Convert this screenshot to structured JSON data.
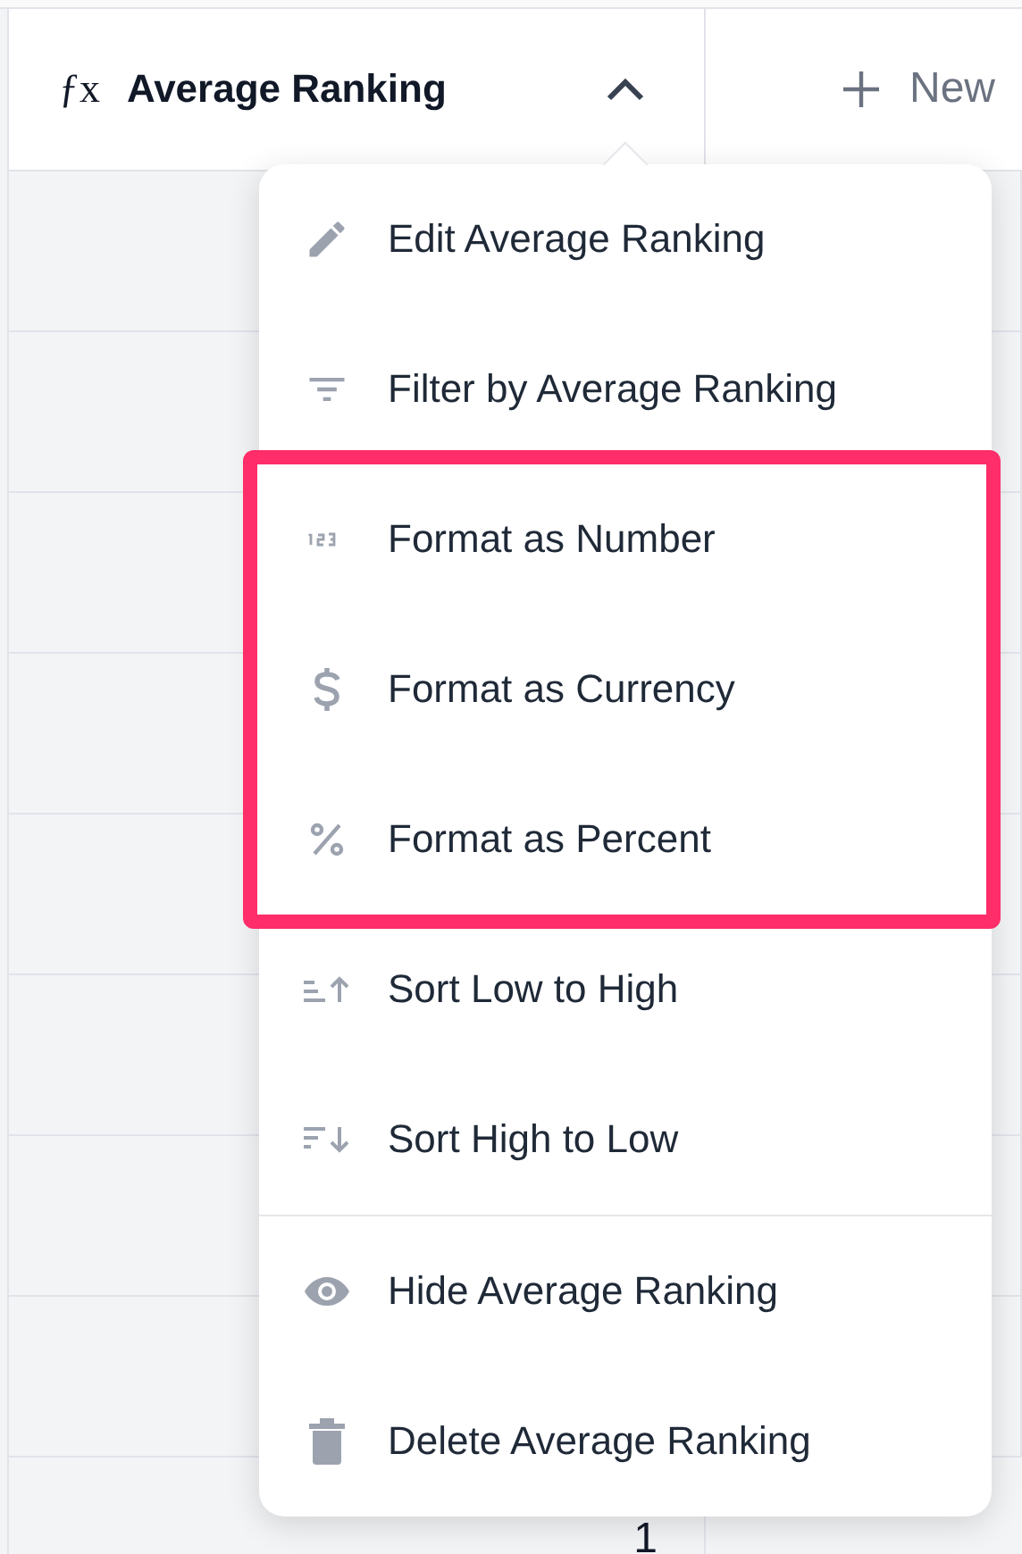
{
  "columns": [
    {
      "title": "Average Ranking",
      "kind": "formula",
      "symbol": "ƒx",
      "expanded": true
    },
    {
      "title": "New",
      "kind": "add"
    }
  ],
  "rows": [
    {
      "average_ranking": "1"
    }
  ],
  "column_menu": {
    "items": [
      {
        "label": "Edit Average Ranking",
        "highlighted": false,
        "divider_before": false
      },
      {
        "label": "Filter by Average Ranking",
        "highlighted": false,
        "divider_before": false
      },
      {
        "label": "Format as Number",
        "highlighted": true,
        "divider_before": false
      },
      {
        "label": "Format as Currency",
        "highlighted": true,
        "divider_before": false
      },
      {
        "label": "Format as Percent",
        "highlighted": true,
        "divider_before": false
      },
      {
        "label": "Sort Low to High",
        "highlighted": false,
        "divider_before": false
      },
      {
        "label": "Sort High to Low",
        "highlighted": false,
        "divider_before": false
      },
      {
        "label": "Hide Average Ranking",
        "highlighted": false,
        "divider_before": true
      },
      {
        "label": "Delete Average Ranking",
        "highlighted": false,
        "divider_before": false
      }
    ]
  }
}
